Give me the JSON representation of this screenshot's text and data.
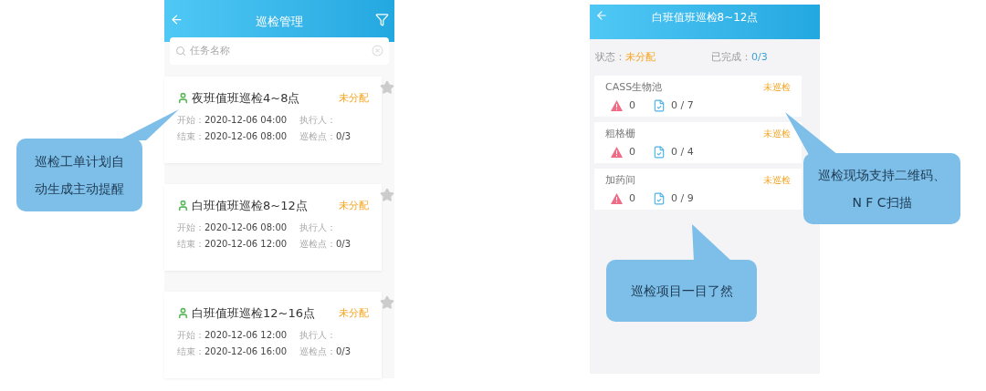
{
  "left_screen": {
    "header": {
      "title": "巡检管理"
    },
    "search": {
      "placeholder": "任务名称"
    },
    "tasks": [
      {
        "title": "夜班值班巡检4~8点",
        "status": "未分配",
        "start_label": "开始：",
        "start": "2020-12-06 04:00",
        "executor_label": "执行人：",
        "end_label": "结束：",
        "end": "2020-12-06 08:00",
        "points_label": "巡检点：",
        "points": "0/3",
        "starred": false
      },
      {
        "title": "白班值班巡检8~12点",
        "status": "未分配",
        "start_label": "开始：",
        "start": "2020-12-06 08:00",
        "executor_label": "执行人：",
        "end_label": "结束：",
        "end": "2020-12-06 12:00",
        "points_label": "巡检点：",
        "points": "0/3",
        "starred": false
      },
      {
        "title": "白班值班巡检12~16点",
        "status": "未分配",
        "start_label": "开始：",
        "start": "2020-12-06 12:00",
        "executor_label": "执行人：",
        "end_label": "结束：",
        "end": "2020-12-06 16:00",
        "points_label": "巡检点：",
        "points": "0/3",
        "starred": false
      }
    ]
  },
  "right_screen": {
    "header": {
      "title": "白班值班巡检8~12点"
    },
    "status_label": "状态：",
    "status": "未分配",
    "done_label": "已完成：",
    "done": "0/3",
    "items": [
      {
        "name": "CASS生物池",
        "status": "未巡检",
        "alarms": "0",
        "progress": "0 / 7"
      },
      {
        "name": "粗格栅",
        "status": "未巡检",
        "alarms": "0",
        "progress": "0 / 4"
      },
      {
        "name": "加药间",
        "status": "未巡检",
        "alarms": "0",
        "progress": "0 / 9"
      }
    ]
  },
  "callouts": [
    {
      "lines": [
        "巡检工单计划自",
        "动生成主动提醒"
      ]
    },
    {
      "lines": [
        "巡检现场支持二维码、",
        "N F C扫描"
      ]
    },
    {
      "lines": [
        "巡检项目一目了然"
      ]
    }
  ]
}
